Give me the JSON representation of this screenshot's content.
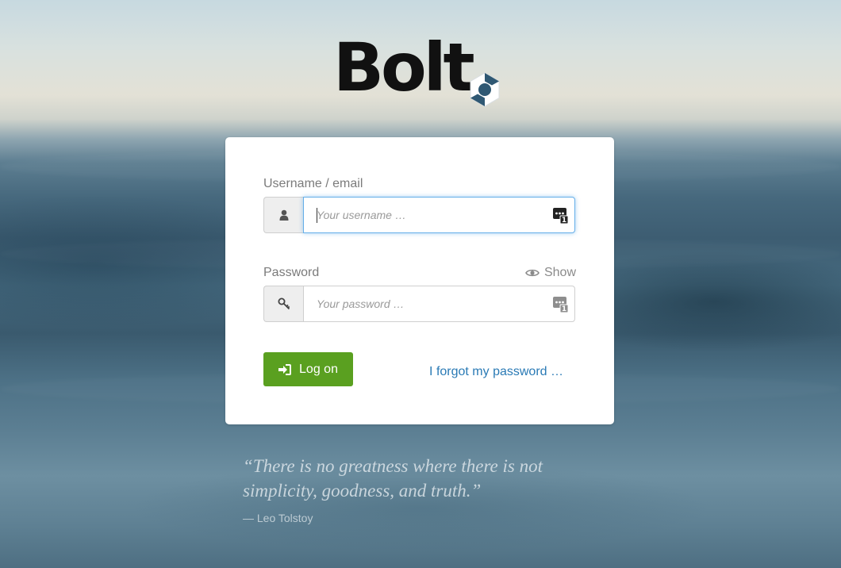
{
  "brand": {
    "name": "Bolt",
    "mark_icon": "hexagon-bolt-icon",
    "text_color": "#111111",
    "mark_color": "#2f5873"
  },
  "login": {
    "username": {
      "label": "Username / email",
      "placeholder": "Your username …",
      "value": "",
      "addon_icon": "user-icon",
      "focused": true
    },
    "password": {
      "label": "Password",
      "placeholder": "Your password …",
      "value": "",
      "addon_icon": "key-icon",
      "show_label": "Show",
      "show_icon": "eye-icon"
    },
    "password_manager_icon": "password-manager-icon",
    "password_manager_badge": "1",
    "submit": {
      "label": "Log on",
      "icon": "sign-in-icon",
      "color": "#5aa020"
    },
    "forgot_link": "I forgot my password …",
    "link_color": "#2a7ab5"
  },
  "quote": {
    "text": "“There is no greatness where there is not simplicity, goodness, and truth.”",
    "author": "— Leo Tolstoy"
  }
}
